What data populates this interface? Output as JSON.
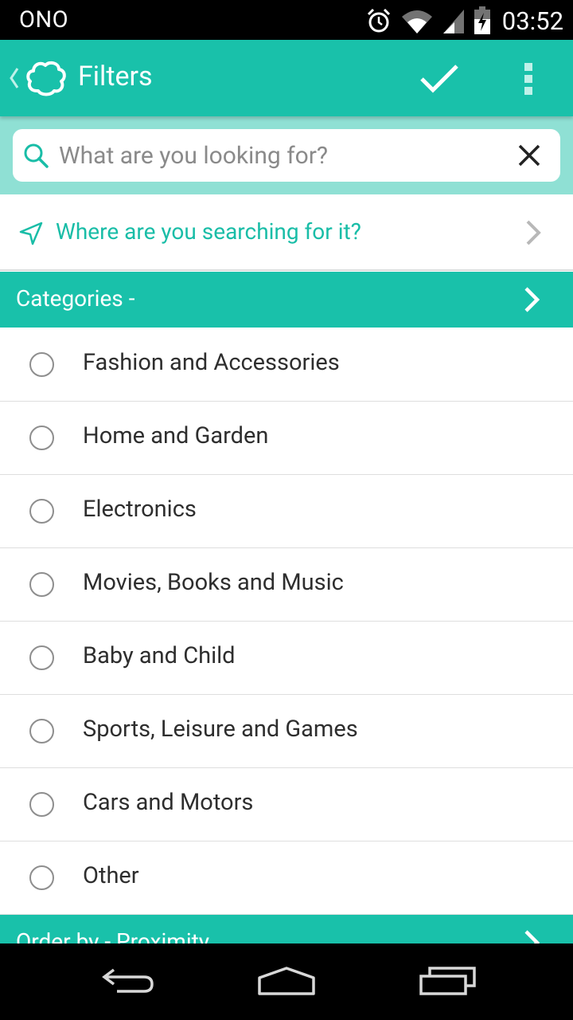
{
  "status_bar": {
    "carrier": "ONO",
    "time": "03:52",
    "icons": [
      "alarm-icon",
      "wifi-icon",
      "signal-icon",
      "battery-icon"
    ]
  },
  "app_bar": {
    "title": "Filters",
    "icons": [
      "back-chevron-icon",
      "app-logo-icon",
      "checkmark-icon",
      "overflow-menu-icon"
    ]
  },
  "search": {
    "placeholder": "What are you looking for?",
    "value": ""
  },
  "location": {
    "label": "Where are you searching for it?"
  },
  "categories": {
    "header": "Categories -",
    "items": [
      {
        "label": "Fashion and Accessories",
        "selected": false
      },
      {
        "label": "Home and Garden",
        "selected": false
      },
      {
        "label": "Electronics",
        "selected": false
      },
      {
        "label": "Movies, Books and Music",
        "selected": false
      },
      {
        "label": "Baby and Child",
        "selected": false
      },
      {
        "label": "Sports, Leisure and Games",
        "selected": false
      },
      {
        "label": "Cars and Motors",
        "selected": false
      },
      {
        "label": "Other",
        "selected": false
      }
    ]
  },
  "order_by": {
    "header": "Order by - Proximity"
  },
  "colors": {
    "accent": "#19c1aa",
    "accent_light": "#8fe0d4",
    "link_text": "#19bda7"
  }
}
